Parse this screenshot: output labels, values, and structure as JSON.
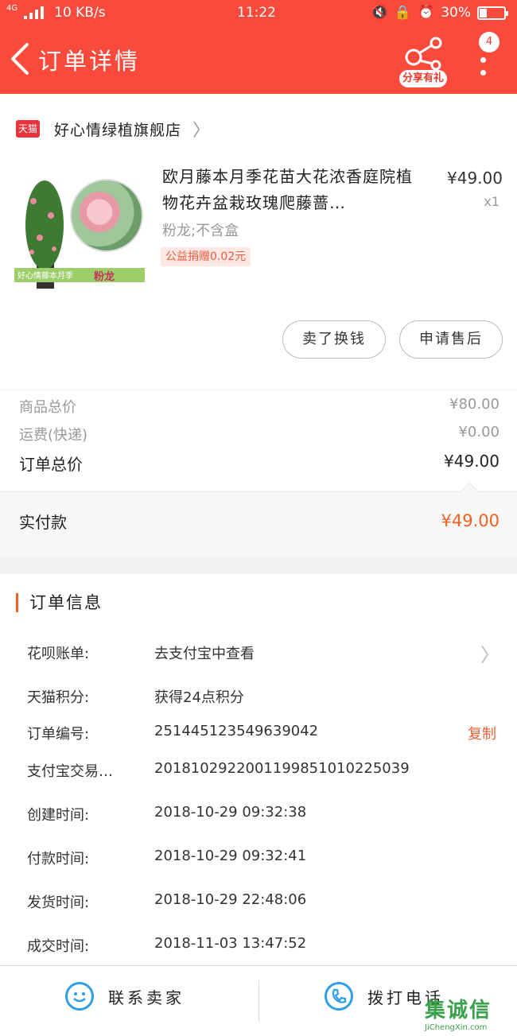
{
  "status_bar": {
    "network": "4G",
    "speed": "10 KB/s",
    "time": "11:22",
    "battery": "30%",
    "battery_level": 0.3
  },
  "nav": {
    "title": "订单详情",
    "share_label": "分享有礼",
    "badge_count": "4"
  },
  "store": {
    "badge": "天猫",
    "name": "好心情绿植旗舰店"
  },
  "product": {
    "title": "欧月藤本月季花苗大花浓香庭院植物花卉盆栽玫瑰爬藤蔷…",
    "price": "¥49.00",
    "quantity": "x1",
    "spec": "粉龙;不含盒",
    "charity": "公益捐赠0.02元",
    "image_caption_left": "好心情藤本月季",
    "image_caption_right": "粉龙"
  },
  "actions": {
    "sell": "卖了换钱",
    "after_sale": "申请售后"
  },
  "summary": {
    "goods_label": "商品总价",
    "goods_value": "¥80.00",
    "shipping_label": "运费(快递)",
    "shipping_value": "¥0.00",
    "total_label": "订单总价",
    "total_value": "¥49.00",
    "paid_label": "实付款",
    "paid_value": "¥49.00"
  },
  "order_info": {
    "title": "订单信息",
    "rows": [
      {
        "key": "花呗账单:",
        "value": "去支付宝中查看"
      },
      {
        "key": "天猫积分:",
        "value": "获得24点积分"
      },
      {
        "key": "订单编号:",
        "value": "251445123549639042",
        "action": "复制"
      },
      {
        "key": "支付宝交易…",
        "value": "2018102922001199851010225039"
      },
      {
        "key": "创建时间:",
        "value": "2018-10-29 09:32:38"
      },
      {
        "key": "付款时间:",
        "value": "2018-10-29 09:32:41"
      },
      {
        "key": "发货时间:",
        "value": "2018-10-29 22:48:06"
      },
      {
        "key": "成交时间:",
        "value": "2018-11-03 13:47:52"
      }
    ]
  },
  "bottom_bar": {
    "contact": "联系卖家",
    "call": "拨打电话"
  },
  "watermark": {
    "logo": "集诚信",
    "url": "JiChengXin.com"
  },
  "colors": {
    "header": "#fa4a3c",
    "accent": "#f06020",
    "icon_blue": "#2ea0e6"
  }
}
